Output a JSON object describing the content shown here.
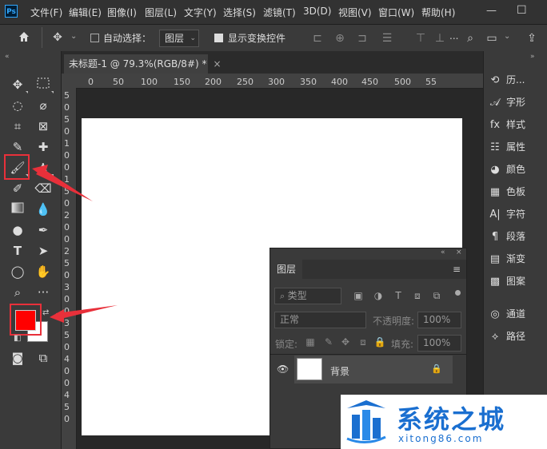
{
  "app": {
    "logo": "Ps"
  },
  "menu": [
    "文件(F)",
    "编辑(E)",
    "图像(I)",
    "图层(L)",
    "文字(Y)",
    "选择(S)",
    "滤镜(T)",
    "3D(D)",
    "视图(V)",
    "窗口(W)",
    "帮助(H)"
  ],
  "window_controls": {
    "minimize": "—",
    "maximize": "☐"
  },
  "options": {
    "auto_select_label": "自动选择：",
    "auto_select_value": "图层",
    "show_transform_label": "显示变换控件",
    "more": "..."
  },
  "document": {
    "tab_title": "未标题-1 @ 79.3%(RGB/8#) *",
    "close": "×",
    "ruler_h": [
      "0",
      "50",
      "100",
      "150",
      "200",
      "250",
      "300",
      "350",
      "400",
      "450",
      "500",
      "55"
    ],
    "ruler_v": [
      "5",
      "0",
      "5",
      "0",
      "1",
      "0",
      "0",
      "1",
      "5",
      "0",
      "2",
      "0",
      "0",
      "2",
      "5",
      "0",
      "3",
      "0",
      "0",
      "3",
      "5",
      "0",
      "4",
      "0",
      "0",
      "4",
      "5",
      "0"
    ]
  },
  "right_panel": {
    "items": [
      {
        "icon": "history-icon",
        "label": "历..."
      },
      {
        "icon": "glyph-icon",
        "label": "字形"
      },
      {
        "icon": "style-icon",
        "label": "样式"
      },
      {
        "icon": "properties-icon",
        "label": "属性"
      },
      {
        "icon": "color-icon",
        "label": "颜色"
      },
      {
        "icon": "swatches-icon",
        "label": "色板"
      },
      {
        "icon": "character-icon",
        "label": "字符"
      },
      {
        "icon": "paragraph-icon",
        "label": "段落"
      },
      {
        "icon": "gradient-icon",
        "label": "渐变"
      },
      {
        "icon": "pattern-icon",
        "label": "图案"
      },
      {
        "icon": "channels-icon",
        "label": "通道"
      },
      {
        "icon": "paths-icon",
        "label": "路径"
      }
    ]
  },
  "layers_panel": {
    "title": "图层",
    "filter_placeholder": "类型",
    "blend_mode": "正常",
    "opacity_label": "不透明度:",
    "opacity_value": "100%",
    "lock_label": "锁定:",
    "fill_label": "填充:",
    "fill_value": "100%",
    "layer_name": "背景"
  },
  "colors": {
    "foreground": "#ff0000",
    "background": "#ffffff",
    "accent_red": "#e8303a",
    "highlight_box": "#e8303a"
  },
  "watermark": {
    "title": "系统之城",
    "url": "xitong86.com"
  }
}
